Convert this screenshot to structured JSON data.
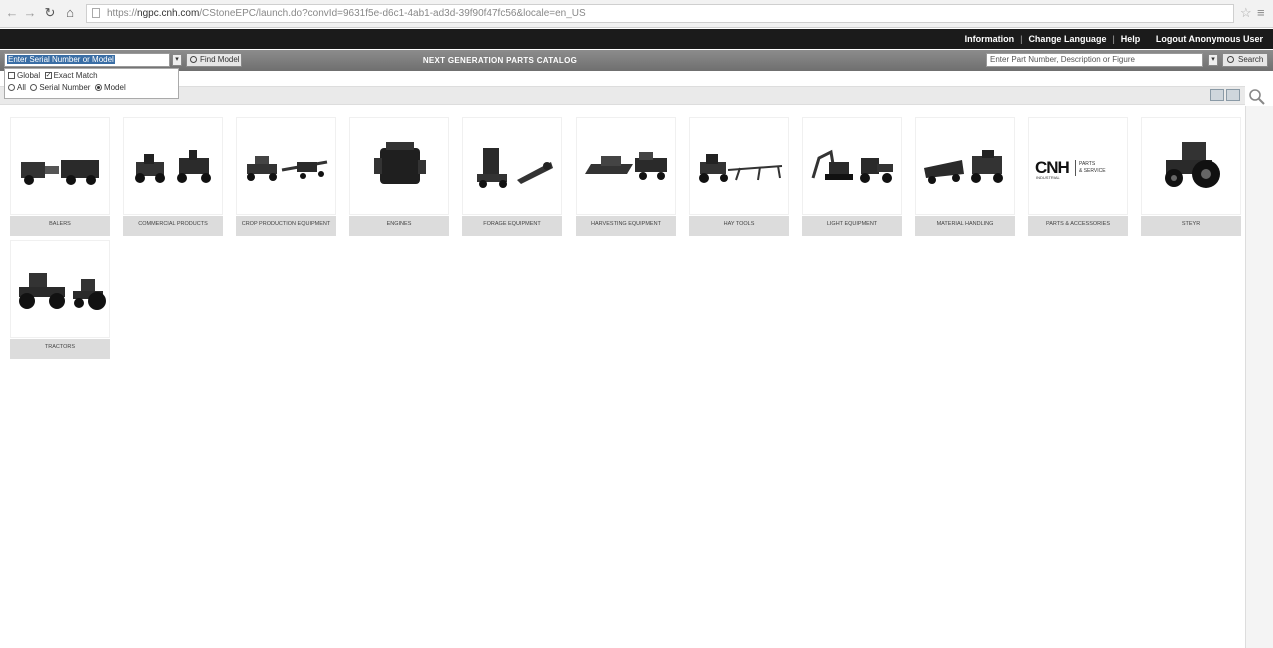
{
  "browser": {
    "url_host": "ngpc.cnh.com",
    "url_rest": "/CStoneEPC/launch.do?convId=9631f5e-d6c1-4ab1-ad3d-39f90f47fc56&locale=en_US",
    "url_prefix": "https://"
  },
  "top_nav": {
    "items": [
      "Information",
      "Change Language",
      "Help",
      "Logout Anonymous User"
    ],
    "sep": "|"
  },
  "search_bar": {
    "serial_placeholder": "Enter Serial Number or Model",
    "find_model_label": "Find Model",
    "catalog_title": "NEXT GENERATION PARTS CATALOG",
    "part_placeholder": "Enter Part Number, Description or Figure",
    "search_label": "Search"
  },
  "options": {
    "global_label": "Global",
    "exact_match_label": "Exact Match",
    "all_label": "All",
    "serial_number_label": "Serial Number",
    "model_label": "Model",
    "global_checked": false,
    "exact_match_checked": true,
    "selected_radio": "Model"
  },
  "categories": [
    {
      "label": "BALERS",
      "icon": "baler-icon"
    },
    {
      "label": "COMMERCIAL PRODUCTS",
      "icon": "mower-icon"
    },
    {
      "label": "CROP PRODUCTION EQUIPMENT",
      "icon": "planter-icon"
    },
    {
      "label": "ENGINES",
      "icon": "engine-icon"
    },
    {
      "label": "FORAGE EQUIPMENT",
      "icon": "forage-icon"
    },
    {
      "label": "HARVESTING EQUIPMENT",
      "icon": "combine-header-icon"
    },
    {
      "label": "HAY TOOLS",
      "icon": "hay-tool-icon"
    },
    {
      "label": "LIGHT EQUIPMENT",
      "icon": "excavator-icon"
    },
    {
      "label": "MATERIAL HANDLING",
      "icon": "material-handling-icon"
    },
    {
      "label": "PARTS & ACCESSORIES",
      "icon": "cnh-logo"
    },
    {
      "label": "STEYR",
      "icon": "tractor-icon"
    },
    {
      "label": "TRACTORS",
      "icon": "tractors-icon"
    }
  ],
  "cnh_logo_text": {
    "main": "CNH",
    "sub": "INDUSTRIAL",
    "tag1": "PARTS",
    "tag2": "& SERVICE"
  }
}
